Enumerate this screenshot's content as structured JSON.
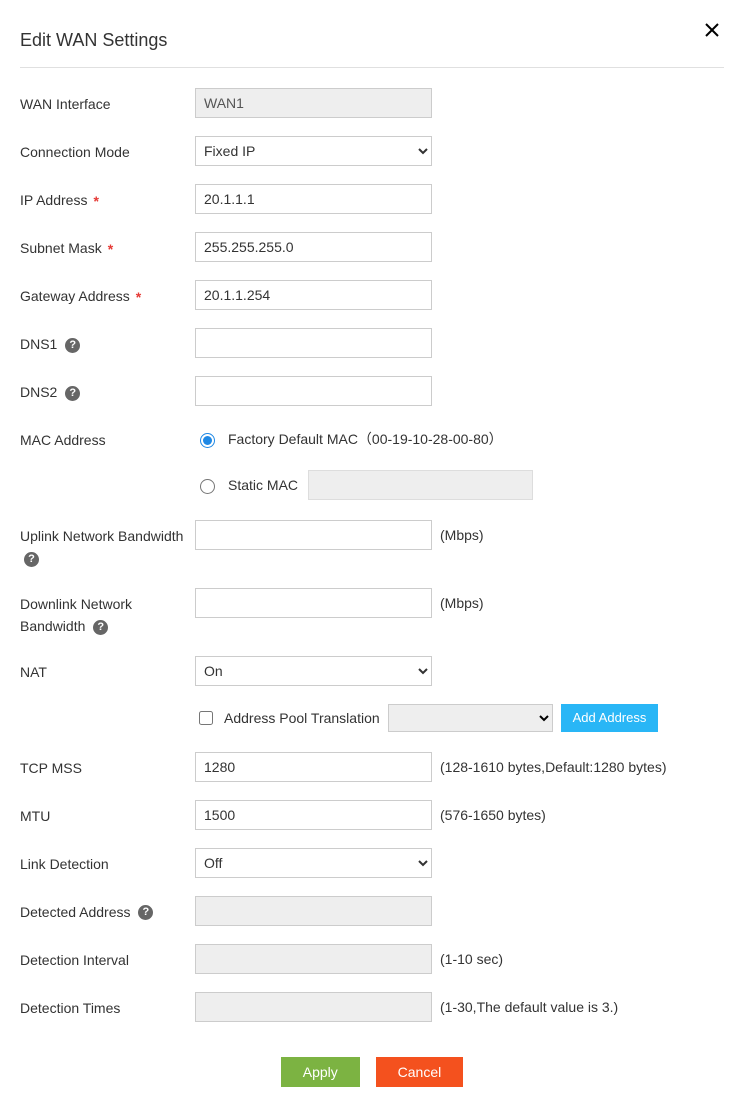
{
  "dialog": {
    "title": "Edit WAN Settings"
  },
  "labels": {
    "wan_interface": "WAN Interface",
    "connection_mode": "Connection Mode",
    "ip_address": "IP Address",
    "subnet_mask": "Subnet Mask",
    "gateway_address": "Gateway Address",
    "dns1": "DNS1",
    "dns2": "DNS2",
    "mac_address": "MAC Address",
    "uplink": "Uplink Network Bandwidth",
    "downlink": "Downlink Network Bandwidth",
    "nat": "NAT",
    "pool": "Address Pool Translation",
    "tcp_mss": "TCP MSS",
    "mtu": "MTU",
    "link_detection": "Link Detection",
    "detected_address": "Detected Address",
    "detection_interval": "Detection Interval",
    "detection_times": "Detection Times"
  },
  "values": {
    "wan_interface": "WAN1",
    "connection_mode": "Fixed IP",
    "ip_address": "20.1.1.1",
    "subnet_mask": "255.255.255.0",
    "gateway_address": "20.1.1.254",
    "dns1": "",
    "dns2": "",
    "factory_mac_label": "Factory Default MAC（00-19-10-28-00-80）",
    "static_mac_label": "Static MAC",
    "uplink": "",
    "downlink": "",
    "nat": "On",
    "tcp_mss": "1280",
    "mtu": "1500",
    "link_detection": "Off",
    "detected_address": "",
    "detection_interval": "",
    "detection_times": ""
  },
  "units": {
    "mbps": "(Mbps)",
    "tcp_mss": "(128-1610 bytes,Default:1280 bytes)",
    "mtu": "(576-1650 bytes)",
    "detection_interval": "(1-10 sec)",
    "detection_times": "(1-30,The default value is 3.)"
  },
  "buttons": {
    "add_address": "Add Address",
    "apply": "Apply",
    "cancel": "Cancel"
  },
  "help_glyph": "?"
}
